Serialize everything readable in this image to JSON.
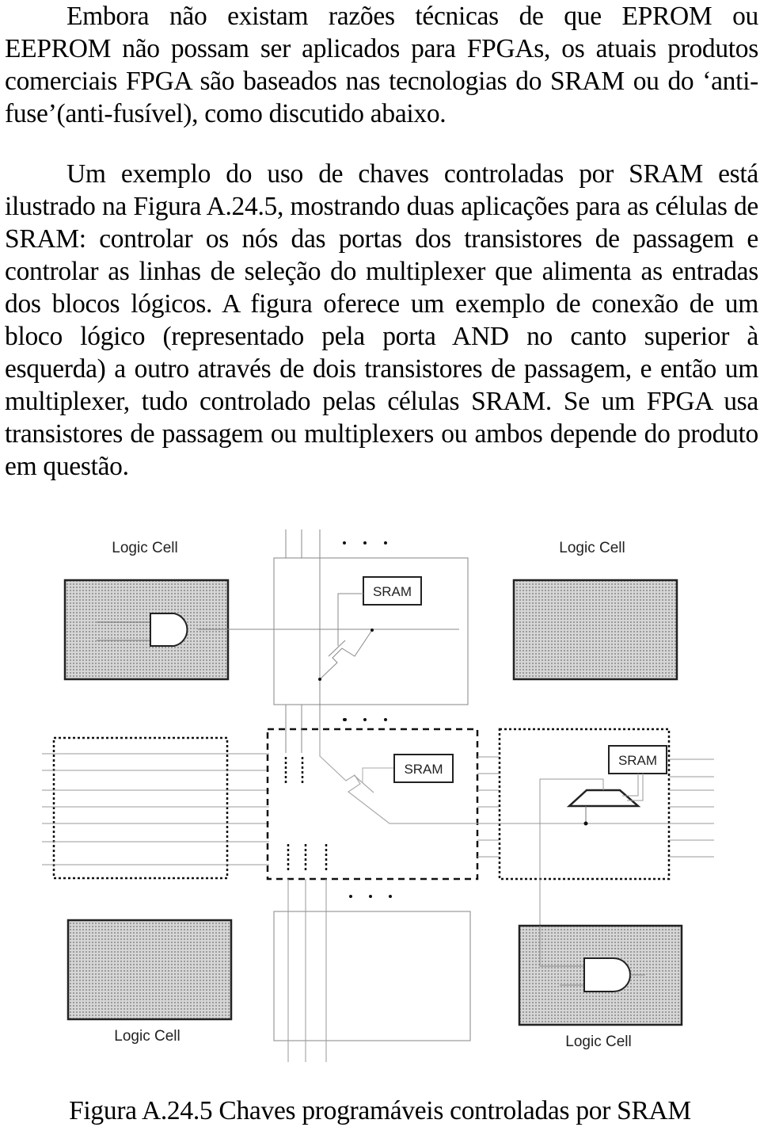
{
  "document": {
    "paragraphs": [
      "Embora não existam razões técnicas de que EPROM ou EEPROM não possam ser aplicados para FPGAs, os atuais produtos comerciais FPGA são baseados nas tecnologias do SRAM ou do ‘anti-fuse’(anti-fusível), como discutido abaixo.",
      "Um exemplo do uso de chaves controladas por SRAM está ilustrado na Figura A.24.5, mostrando duas aplicações para as células de SRAM: controlar os nós das portas dos transistores de passagem e controlar as linhas de seleção do multiplexer que alimenta as entradas dos blocos lógicos. A figura oferece um exemplo de conexão de um bloco lógico (representado pela porta AND no canto superior à esquerda) a outro através de dois transistores de passagem, e então um multiplexer, tudo controlado pelas células SRAM. Se um FPGA usa transistores de passagem ou multiplexers ou ambos depende do produto em questão."
    ],
    "figure": {
      "labels": {
        "logic_cell_top_left": "Logic Cell",
        "logic_cell_top_right": "Logic Cell",
        "logic_cell_bottom_left": "Logic Cell",
        "logic_cell_bottom_right": "Logic Cell",
        "sram_top": "SRAM",
        "sram_middle": "SRAM",
        "sram_mux": "SRAM"
      },
      "caption": "Figura A.24.5 Chaves programáveis controladas por SRAM"
    }
  }
}
